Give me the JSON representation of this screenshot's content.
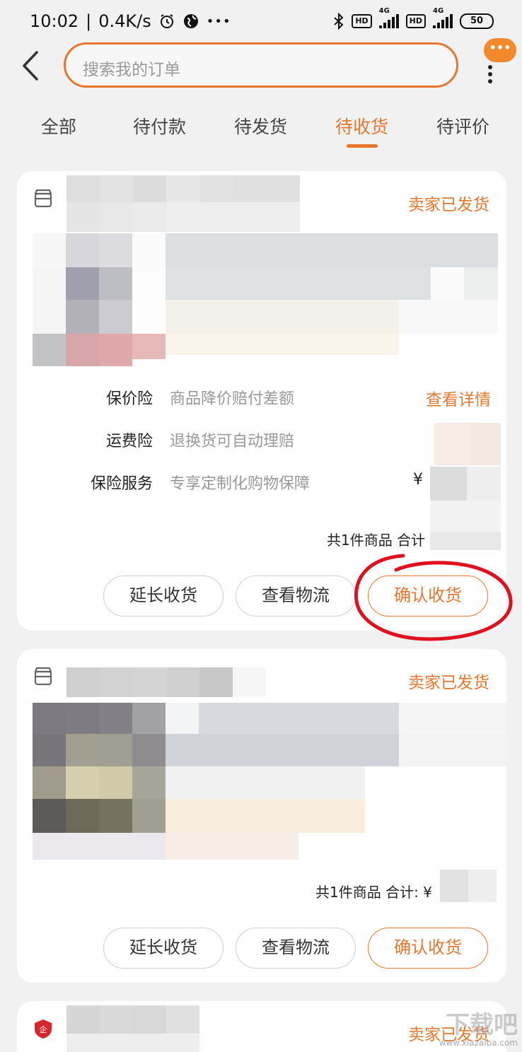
{
  "status_bar": {
    "time": "10:02",
    "speed": "0.4K/s",
    "ellipsis": "•••",
    "hd1": "HD",
    "hd2": "HD",
    "net1": "4G",
    "net2": "4G",
    "battery": "50"
  },
  "header": {
    "search_placeholder": "搜索我的订单",
    "more_badge": "•••"
  },
  "tabs": [
    {
      "label": "全部"
    },
    {
      "label": "待付款"
    },
    {
      "label": "待发货"
    },
    {
      "label": "待收货",
      "active": true
    },
    {
      "label": "待评价"
    }
  ],
  "orders": [
    {
      "status": "卖家已发货",
      "insurance": [
        {
          "label": "保价险",
          "desc": "商品降价赔付差额"
        },
        {
          "label": "运费险",
          "desc": "退换货可自动理赔"
        },
        {
          "label": "保险服务",
          "desc": "专享定制化购物保障"
        }
      ],
      "detail_link": "查看详情",
      "currency": "¥",
      "total": "共1件商品  合计",
      "buttons": {
        "extend": "延长收货",
        "logistics": "查看物流",
        "confirm": "确认收货"
      }
    },
    {
      "status": "卖家已发货",
      "total": "共1件商品  合计: ¥",
      "buttons": {
        "extend": "延长收货",
        "logistics": "查看物流",
        "confirm": "确认收货"
      }
    },
    {
      "status": "卖家已发货"
    }
  ],
  "watermark": {
    "big": "下载吧",
    "small": "www.xiazaiba.com"
  },
  "colors": {
    "accent": "#e8772e",
    "annotation": "#e0101e"
  }
}
